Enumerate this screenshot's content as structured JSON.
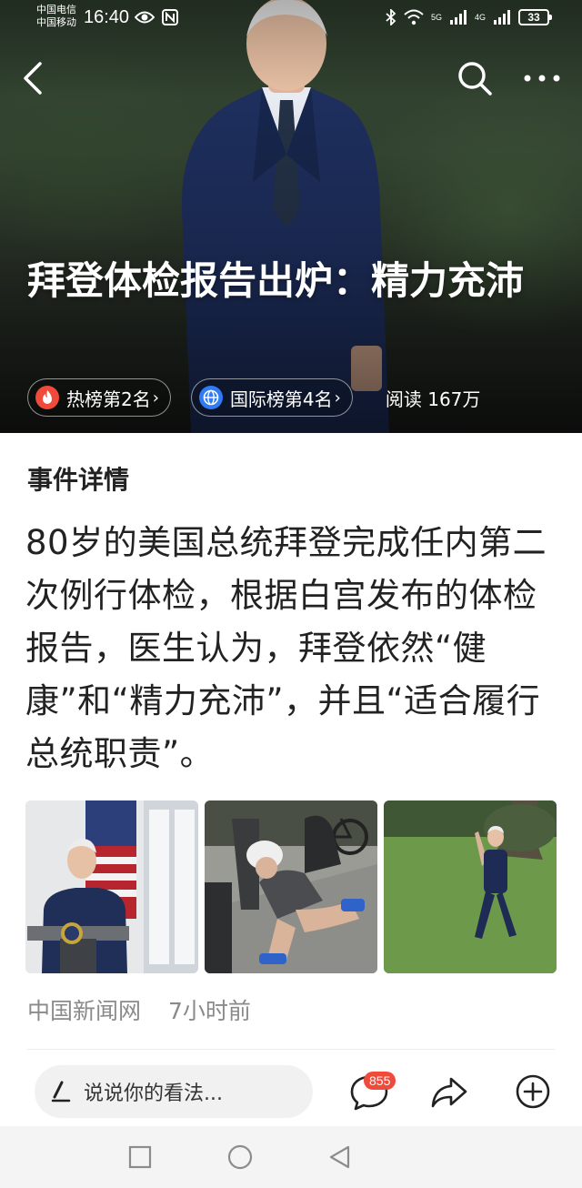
{
  "status_bar": {
    "carrier_1": "中国电信",
    "carrier_2": "中国移动",
    "time": "16:40",
    "net_1": "5G",
    "net_2": "4G",
    "battery": "33",
    "icons": [
      "eye-icon",
      "nfc-icon",
      "bluetooth-icon",
      "wifi-icon",
      "signal-icon",
      "battery-icon"
    ]
  },
  "nav": {
    "back_icon": "back-chevron-icon",
    "search_icon": "search-icon",
    "more_icon": "more-icon"
  },
  "hero": {
    "title": "拜登体检报告出炉：精力充沛",
    "tags": [
      {
        "label": "热榜第2名",
        "icon": "fire-icon",
        "color": "#f04a3b"
      },
      {
        "label": "国际榜第4名",
        "icon": "globe-icon",
        "color": "#2f7cf6"
      }
    ],
    "reads": "阅读 167万"
  },
  "content": {
    "section_title": "事件详情",
    "summary": "80岁的美国总统拜登完成任内第二次例行体检，根据白宫发布的体检报告，医生认为，拜登依然“健康”和“精力充沛”，并且“适合履行总统职责”。",
    "source": "中国新闻网",
    "time_ago": "7小时前"
  },
  "action_bar": {
    "comment_placeholder": "说说你的看法...",
    "comment_count": "855",
    "icons": [
      "pen-icon",
      "comment-icon",
      "share-icon",
      "add-icon"
    ]
  },
  "colors": {
    "hot_red": "#f04a3b",
    "globe_blue": "#2f7cf6",
    "text_dark": "#222222",
    "text_gray": "#8a8a8a"
  }
}
